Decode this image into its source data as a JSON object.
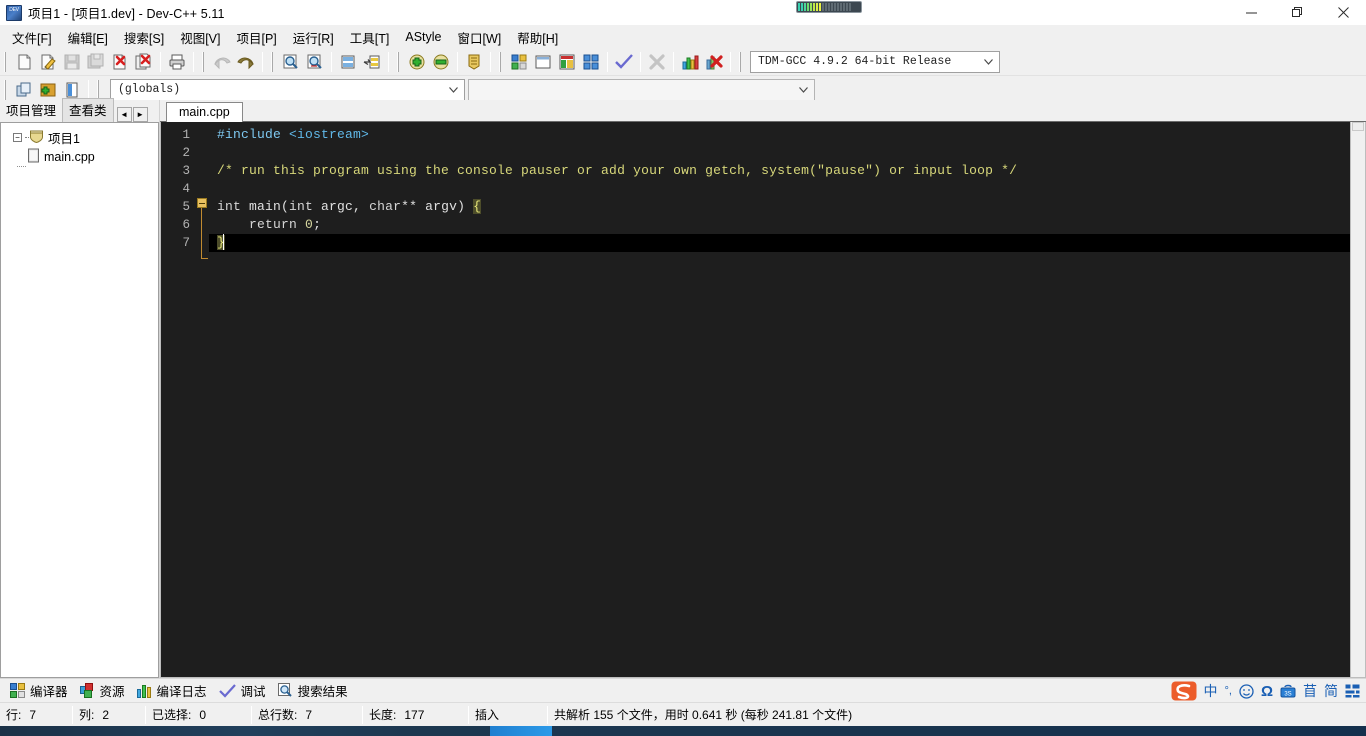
{
  "window": {
    "title": "项目1 - [项目1.dev] - Dev-C++ 5.11",
    "app_icon": "dev-cpp-icon",
    "minimize_label": "—",
    "maximize_label": "❐",
    "close_label": "✕"
  },
  "menubar": {
    "items": [
      {
        "label": "文件[F]",
        "name": "menu-file"
      },
      {
        "label": "编辑[E]",
        "name": "menu-edit"
      },
      {
        "label": "搜索[S]",
        "name": "menu-search"
      },
      {
        "label": "视图[V]",
        "name": "menu-view"
      },
      {
        "label": "项目[P]",
        "name": "menu-project"
      },
      {
        "label": "运行[R]",
        "name": "menu-run"
      },
      {
        "label": "工具[T]",
        "name": "menu-tools"
      },
      {
        "label": "AStyle",
        "name": "menu-astyle"
      },
      {
        "label": "窗口[W]",
        "name": "menu-window"
      },
      {
        "label": "帮助[H]",
        "name": "menu-help"
      }
    ]
  },
  "toolbar": {
    "compiler_value": "TDM-GCC 4.9.2 64-bit Release",
    "globals_value": "(globals)",
    "class_value": "",
    "dropdown_arrow": "⌄"
  },
  "left_panel": {
    "tabs": [
      {
        "label": "项目管理",
        "name": "tab-project-manager",
        "active": true
      },
      {
        "label": "查看类",
        "name": "tab-class-browser",
        "active": false
      }
    ],
    "nav_prev": "◄",
    "nav_next": "►",
    "tree": {
      "root_label": "项目1",
      "root_toggle": "−",
      "children": [
        {
          "label": "main.cpp"
        }
      ]
    }
  },
  "editor": {
    "tabs": [
      {
        "label": "main.cpp",
        "active": true
      }
    ],
    "line_numbers": [
      "1",
      "2",
      "3",
      "4",
      "5",
      "6",
      "7"
    ],
    "lines": [
      {
        "n": "1",
        "text": "#include <iostream>"
      },
      {
        "n": "2",
        "text": ""
      },
      {
        "n": "3",
        "text": "/* run this program using the console pauser or add your own getch, system(\"pause\") or input loop */"
      },
      {
        "n": "4",
        "text": ""
      },
      {
        "n": "5",
        "text": "int main(int argc, char** argv) {"
      },
      {
        "n": "6",
        "text": "    return 0;"
      },
      {
        "n": "7",
        "text": "}"
      }
    ],
    "colors": {
      "background": "#1e1e1e",
      "preprocessor": "#7ec8f0",
      "comment": "#d7d77a",
      "text": "#e0e0e0",
      "current_line": "#000000",
      "brace_highlight": "#e8e87a",
      "gutter_text": "#b3b3b3",
      "fold_marker": "#e8c060"
    }
  },
  "bottom_tabs": [
    {
      "label": "编译器",
      "name": "tab-compiler",
      "icon": "grid-icon"
    },
    {
      "label": "资源",
      "name": "tab-resources",
      "icon": "blocks-icon"
    },
    {
      "label": "编译日志",
      "name": "tab-compile-log",
      "icon": "chart-icon"
    },
    {
      "label": "调试",
      "name": "tab-debug",
      "icon": "check-icon"
    },
    {
      "label": "搜索结果",
      "name": "tab-search-results",
      "icon": "magnifier-icon"
    }
  ],
  "ime_tray": {
    "items": [
      {
        "glyph": "S",
        "name": "sogou-logo-icon"
      },
      {
        "glyph": "中",
        "name": "chinese-mode-icon"
      },
      {
        "glyph": "°,",
        "name": "punctuation-icon"
      },
      {
        "glyph": "☺",
        "name": "emoji-icon"
      },
      {
        "glyph": "Ω",
        "name": "symbols-icon"
      },
      {
        "glyph": "3S",
        "name": "toolbox-icon"
      },
      {
        "glyph": "苜",
        "name": "skin-icon"
      },
      {
        "glyph": "简",
        "name": "simplified-icon"
      },
      {
        "glyph": "▒",
        "name": "menu-grid-icon"
      }
    ]
  },
  "statusbar": {
    "cells": [
      {
        "label": "行:",
        "value": "7",
        "name": "status-row"
      },
      {
        "label": "列:",
        "value": "2",
        "name": "status-col"
      },
      {
        "label": "已选择:",
        "value": "0",
        "name": "status-selected"
      },
      {
        "label": "总行数:",
        "value": "7",
        "name": "status-total-lines"
      },
      {
        "label": "长度:",
        "value": "177",
        "name": "status-length"
      },
      {
        "label": "插入",
        "value": "",
        "name": "status-insert-mode"
      }
    ],
    "parse_info": "共解析 155 个文件，用时 0.641 秒 (每秒 241.81 个文件)"
  }
}
